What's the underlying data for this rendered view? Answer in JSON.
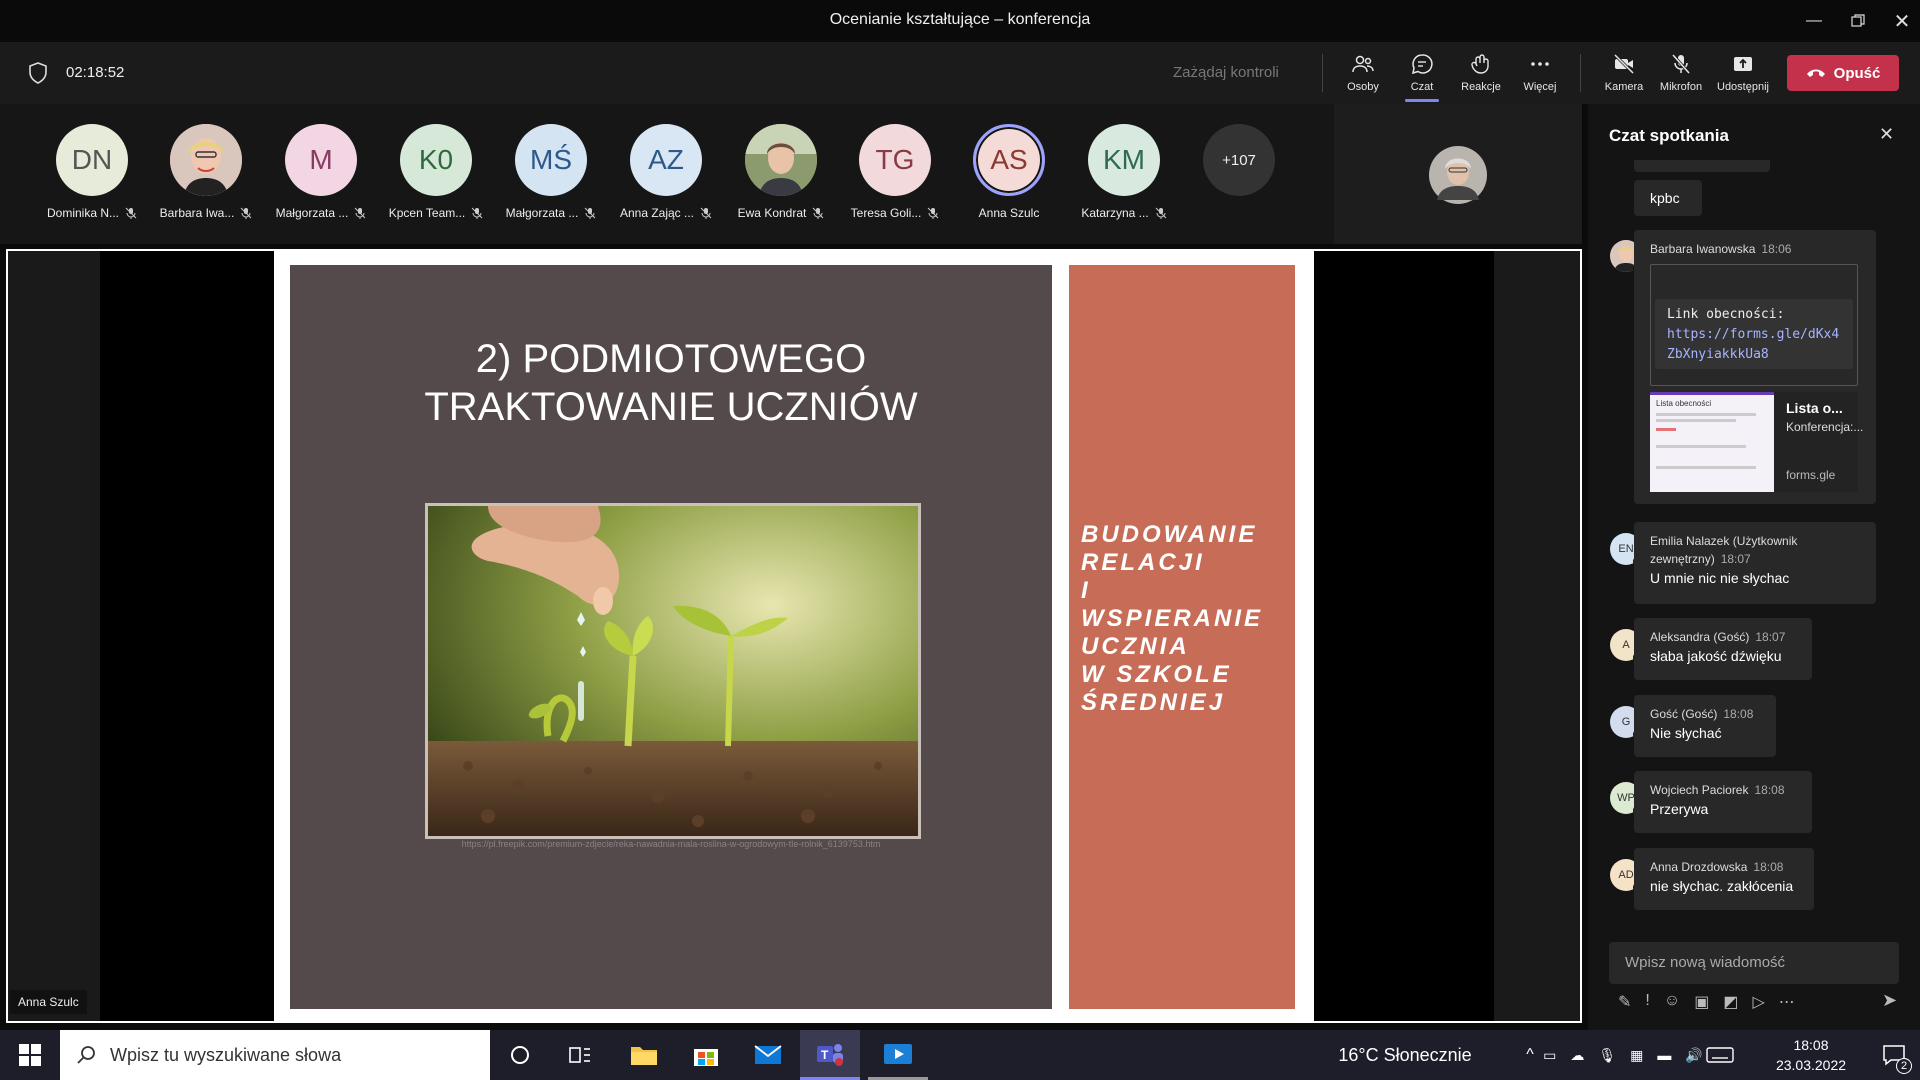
{
  "window": {
    "title": "Ocenianie kształtujące – konferencja"
  },
  "toolbar": {
    "timer": "02:18:52",
    "request_control": "Zażądaj kontroli",
    "people": "Osoby",
    "chat": "Czat",
    "reactions": "Reakcje",
    "more": "Więcej",
    "camera": "Kamera",
    "microphone": "Mikrofon",
    "share": "Udostępnij",
    "leave": "Opuść"
  },
  "participants": [
    {
      "initials": "DN",
      "name": "Dominika N...",
      "color": "#e6ecd9"
    },
    {
      "initials": "",
      "name": "Barbara Iwa...",
      "color": "#e8b7b0"
    },
    {
      "initials": "M",
      "name": "Małgorzata ...",
      "color": "#f3d6e4"
    },
    {
      "initials": "K0",
      "name": "Kpcen Team...",
      "color": "#d6e9d8"
    },
    {
      "initials": "MŚ",
      "name": "Małgorzata ...",
      "color": "#d5e4f3"
    },
    {
      "initials": "AZ",
      "name": "Anna Zając ...",
      "color": "#d9e6f4"
    },
    {
      "initials": "",
      "name": "Ewa Kondrat",
      "color": "#9aa38a"
    },
    {
      "initials": "TG",
      "name": "Teresa Goli...",
      "color": "#f1d9dc"
    },
    {
      "initials": "AS",
      "name": "Anna Szulc",
      "color": "#f5dbd7"
    },
    {
      "initials": "KM",
      "name": "Katarzyna ...",
      "color": "#d8eadf"
    }
  ],
  "more_participants": "+107",
  "slide": {
    "title_line1": "2) PODMIOTOWEGO",
    "title_line2": "TRAKTOWANIE UCZNIÓW",
    "source_url": "https://pl.freepik.com/premium-zdjecie/reka-nawadnia-mala-roslina-w-ogrodowym-tle-rolnik_6139753.htm",
    "right_lines": [
      "BUDOWANIE",
      "RELACJI",
      "I",
      "WSPIERANIE",
      "UCZNIA",
      "W SZKOLE",
      "ŚREDNIEJ"
    ]
  },
  "presenter_label": "Anna Szulc",
  "chat": {
    "header": "Czat spotkania",
    "first_text": "kpbc",
    "link_message": {
      "author": "Barbara Iwanowska",
      "time": "18:06",
      "code_label": "Link obecności:",
      "code_url": "https://forms.gle/dKx4ZbXnyiakkkUa8",
      "card_title": "Lista o...",
      "card_sub": "Konferencja:...",
      "card_domain": "forms.gle",
      "thumb_title": "Lista obecności"
    },
    "messages": [
      {
        "initials": "EN",
        "author": "Emilia Nalazek (Użytkownik zewnętrzny)",
        "time": "18:07",
        "text": "U mnie nic nie słychac",
        "color": "#d5e4f3",
        "status": "#f2b600"
      },
      {
        "initials": "A",
        "author": "Aleksandra (Gość)",
        "time": "18:07",
        "text": "słaba jakość dźwięku",
        "color": "#f1e4c8",
        "status": "#ffffff"
      },
      {
        "initials": "G",
        "author": "Gość (Gość)",
        "time": "18:08",
        "text": "Nie słychać",
        "color": "#d3dbef",
        "status": "#ffffff"
      },
      {
        "initials": "WP",
        "author": "Wojciech Paciorek",
        "time": "18:08",
        "text": "Przerywa",
        "color": "#dcead2",
        "status": "#d13438"
      },
      {
        "initials": "AD",
        "author": "Anna Drozdowska",
        "time": "18:08",
        "text": "nie słychac. zakłócenia",
        "color": "#f6e2c6",
        "status": "#d13438"
      }
    ],
    "compose_placeholder": "Wpisz nową wiadomość"
  },
  "taskbar": {
    "search_placeholder": "Wpisz tu wyszukiwane słowa",
    "weather": "16°C Słonecznie",
    "time": "18:08",
    "date": "23.03.2022",
    "notifications": "2"
  }
}
